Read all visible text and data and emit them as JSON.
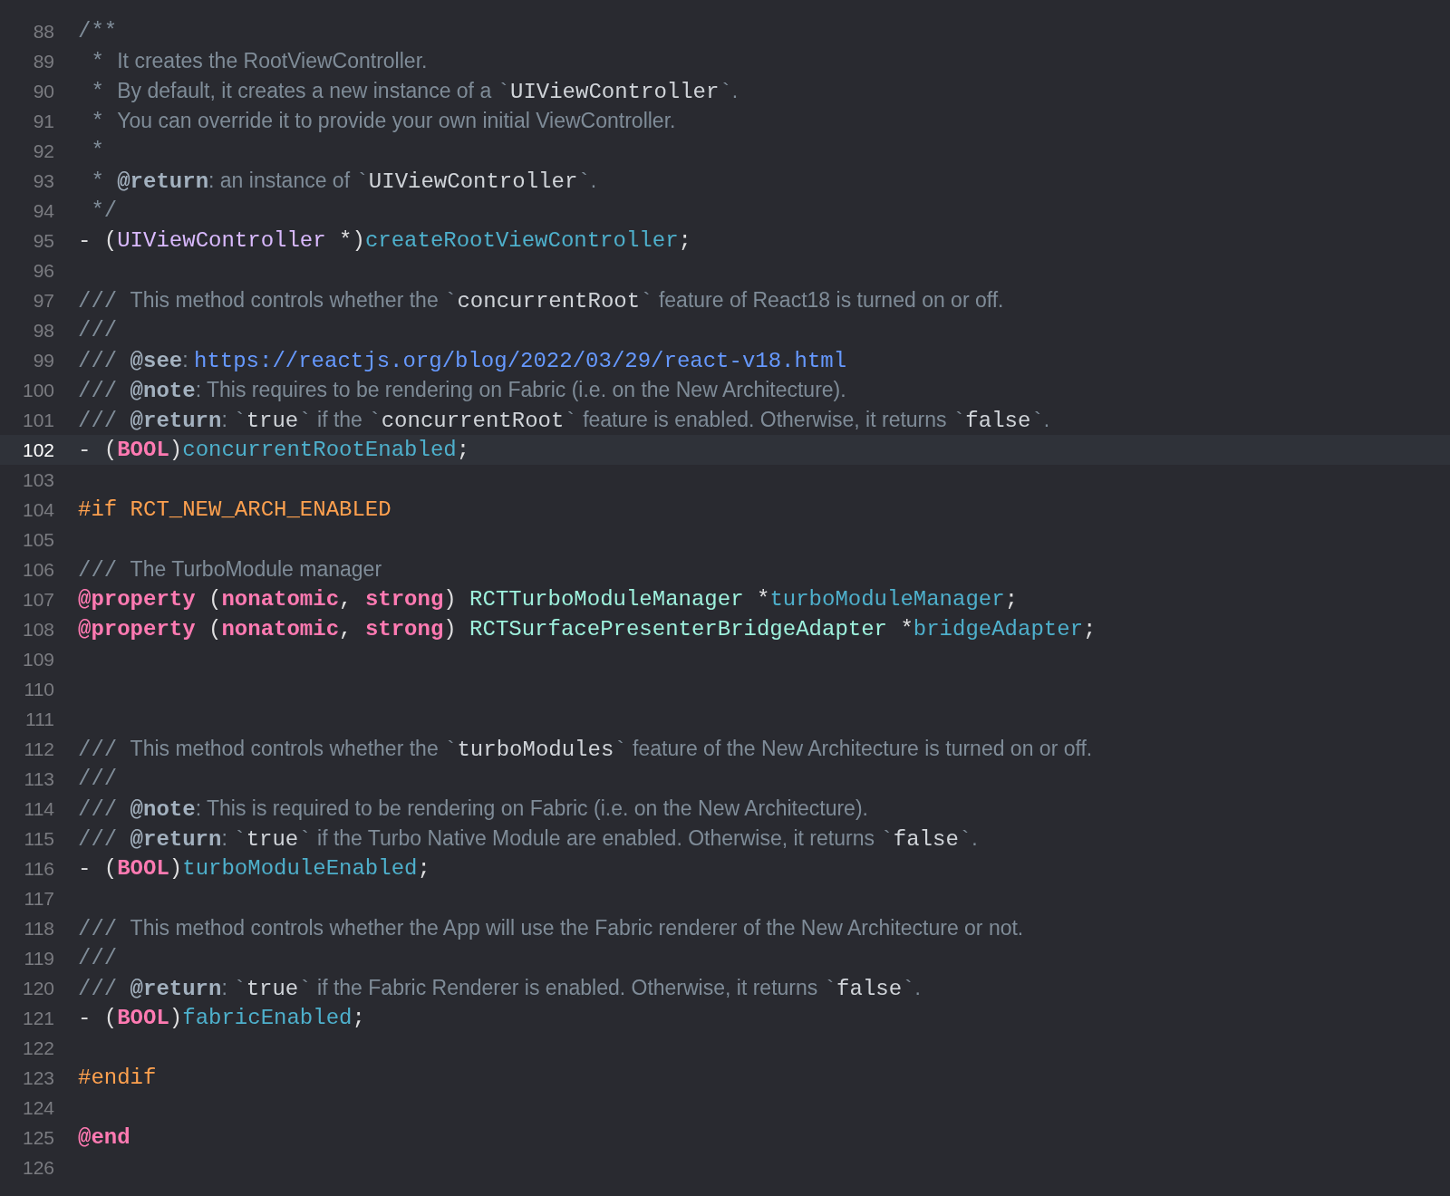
{
  "editor": {
    "lines": [
      {
        "n": "88",
        "current": false,
        "tokens": [
          {
            "kind": "mark",
            "text": "/**"
          }
        ]
      },
      {
        "n": "89",
        "current": false,
        "tokens": [
          {
            "kind": "mark",
            "text": " * "
          },
          {
            "kind": "comment",
            "text": "It creates the RootViewController."
          }
        ]
      },
      {
        "n": "90",
        "current": false,
        "tokens": [
          {
            "kind": "mark",
            "text": " * "
          },
          {
            "kind": "comment",
            "text": "By default, it creates a new instance of a "
          },
          {
            "kind": "mark",
            "text": "`"
          },
          {
            "kind": "code",
            "text": "UIViewController"
          },
          {
            "kind": "mark",
            "text": "`"
          },
          {
            "kind": "comment",
            "text": "."
          }
        ]
      },
      {
        "n": "91",
        "current": false,
        "tokens": [
          {
            "kind": "mark",
            "text": " * "
          },
          {
            "kind": "comment",
            "text": "You can override it to provide your own initial ViewController."
          }
        ]
      },
      {
        "n": "92",
        "current": false,
        "tokens": [
          {
            "kind": "mark",
            "text": " *"
          }
        ]
      },
      {
        "n": "93",
        "current": false,
        "tokens": [
          {
            "kind": "mark",
            "text": " * "
          },
          {
            "kind": "tag",
            "text": "@return"
          },
          {
            "kind": "comment",
            "text": ": an instance of "
          },
          {
            "kind": "mark",
            "text": "`"
          },
          {
            "kind": "code",
            "text": "UIViewController"
          },
          {
            "kind": "mark",
            "text": "`"
          },
          {
            "kind": "comment",
            "text": "."
          }
        ]
      },
      {
        "n": "94",
        "current": false,
        "tokens": [
          {
            "kind": "mark",
            "text": " */"
          }
        ]
      },
      {
        "n": "95",
        "current": false,
        "tokens": [
          {
            "kind": "plain",
            "text": "- ("
          },
          {
            "kind": "type",
            "text": "UIViewController"
          },
          {
            "kind": "plain",
            "text": " *)"
          },
          {
            "kind": "method",
            "text": "createRootViewController"
          },
          {
            "kind": "plain",
            "text": ";"
          }
        ]
      },
      {
        "n": "96",
        "current": false
      },
      {
        "n": "97",
        "current": false,
        "tokens": [
          {
            "kind": "mark",
            "text": "/// "
          },
          {
            "kind": "comment",
            "text": "This method controls whether the "
          },
          {
            "kind": "mark",
            "text": "`"
          },
          {
            "kind": "code",
            "text": "concurrentRoot"
          },
          {
            "kind": "mark",
            "text": "`"
          },
          {
            "kind": "comment",
            "text": " feature of React18 is turned on or off."
          }
        ]
      },
      {
        "n": "98",
        "current": false,
        "tokens": [
          {
            "kind": "mark",
            "text": "///"
          }
        ]
      },
      {
        "n": "99",
        "current": false,
        "tokens": [
          {
            "kind": "mark",
            "text": "/// "
          },
          {
            "kind": "tag",
            "text": "@see"
          },
          {
            "kind": "comment",
            "text": ": "
          },
          {
            "kind": "link",
            "text": "https://reactjs.org/blog/2022/03/29/react-v18.html"
          }
        ]
      },
      {
        "n": "100",
        "current": false,
        "tokens": [
          {
            "kind": "mark",
            "text": "/// "
          },
          {
            "kind": "tag",
            "text": "@note"
          },
          {
            "kind": "comment",
            "text": ": This requires to be rendering on Fabric (i.e. on the New Architecture)."
          }
        ]
      },
      {
        "n": "101",
        "current": false,
        "tokens": [
          {
            "kind": "mark",
            "text": "/// "
          },
          {
            "kind": "tag",
            "text": "@return"
          },
          {
            "kind": "comment",
            "text": ": "
          },
          {
            "kind": "mark",
            "text": "`"
          },
          {
            "kind": "code",
            "text": "true"
          },
          {
            "kind": "mark",
            "text": "`"
          },
          {
            "kind": "comment",
            "text": " if the "
          },
          {
            "kind": "mark",
            "text": "`"
          },
          {
            "kind": "code",
            "text": "concurrentRoot"
          },
          {
            "kind": "mark",
            "text": "`"
          },
          {
            "kind": "comment",
            "text": " feature is enabled. Otherwise, it returns "
          },
          {
            "kind": "mark",
            "text": "`"
          },
          {
            "kind": "code",
            "text": "false"
          },
          {
            "kind": "mark",
            "text": "`"
          },
          {
            "kind": "comment",
            "text": "."
          }
        ]
      },
      {
        "n": "102",
        "current": true,
        "tokens": [
          {
            "kind": "plain",
            "text": "- ("
          },
          {
            "kind": "keyword",
            "text": "BOOL"
          },
          {
            "kind": "plain",
            "text": ")"
          },
          {
            "kind": "method",
            "text": "concurrentRootEnabled"
          },
          {
            "kind": "plain",
            "text": ";"
          }
        ]
      },
      {
        "n": "103",
        "current": false
      },
      {
        "n": "104",
        "current": false,
        "tokens": [
          {
            "kind": "preproc",
            "text": "#if RCT_NEW_ARCH_ENABLED"
          }
        ]
      },
      {
        "n": "105",
        "current": false
      },
      {
        "n": "106",
        "current": false,
        "tokens": [
          {
            "kind": "mark",
            "text": "/// "
          },
          {
            "kind": "comment",
            "text": "The TurboModule manager"
          }
        ]
      },
      {
        "n": "107",
        "current": false,
        "tokens": [
          {
            "kind": "keyword",
            "text": "@property"
          },
          {
            "kind": "plain",
            "text": " ("
          },
          {
            "kind": "keyword",
            "text": "nonatomic"
          },
          {
            "kind": "plain",
            "text": ", "
          },
          {
            "kind": "keyword",
            "text": "strong"
          },
          {
            "kind": "plain",
            "text": ") "
          },
          {
            "kind": "class",
            "text": "RCTTurboModuleManager"
          },
          {
            "kind": "plain",
            "text": " *"
          },
          {
            "kind": "method",
            "text": "turboModuleManager"
          },
          {
            "kind": "plain",
            "text": ";"
          }
        ]
      },
      {
        "n": "108",
        "current": false,
        "tokens": [
          {
            "kind": "keyword",
            "text": "@property"
          },
          {
            "kind": "plain",
            "text": " ("
          },
          {
            "kind": "keyword",
            "text": "nonatomic"
          },
          {
            "kind": "plain",
            "text": ", "
          },
          {
            "kind": "keyword",
            "text": "strong"
          },
          {
            "kind": "plain",
            "text": ") "
          },
          {
            "kind": "class",
            "text": "RCTSurfacePresenterBridgeAdapter"
          },
          {
            "kind": "plain",
            "text": " *"
          },
          {
            "kind": "method",
            "text": "bridgeAdapter"
          },
          {
            "kind": "plain",
            "text": ";"
          }
        ]
      },
      {
        "n": "109",
        "current": false
      },
      {
        "n": "110",
        "current": false
      },
      {
        "n": "111",
        "current": false
      },
      {
        "n": "112",
        "current": false,
        "tokens": [
          {
            "kind": "mark",
            "text": "/// "
          },
          {
            "kind": "comment",
            "text": "This method controls whether the "
          },
          {
            "kind": "mark",
            "text": "`"
          },
          {
            "kind": "code",
            "text": "turboModules"
          },
          {
            "kind": "mark",
            "text": "`"
          },
          {
            "kind": "comment",
            "text": " feature of the New Architecture is turned on or off."
          }
        ]
      },
      {
        "n": "113",
        "current": false,
        "tokens": [
          {
            "kind": "mark",
            "text": "///"
          }
        ]
      },
      {
        "n": "114",
        "current": false,
        "tokens": [
          {
            "kind": "mark",
            "text": "/// "
          },
          {
            "kind": "tag",
            "text": "@note"
          },
          {
            "kind": "comment",
            "text": ": This is required to be rendering on Fabric (i.e. on the New Architecture)."
          }
        ]
      },
      {
        "n": "115",
        "current": false,
        "tokens": [
          {
            "kind": "mark",
            "text": "/// "
          },
          {
            "kind": "tag",
            "text": "@return"
          },
          {
            "kind": "comment",
            "text": ": "
          },
          {
            "kind": "mark",
            "text": "`"
          },
          {
            "kind": "code",
            "text": "true"
          },
          {
            "kind": "mark",
            "text": "`"
          },
          {
            "kind": "comment",
            "text": " if the Turbo Native Module are enabled. Otherwise, it returns "
          },
          {
            "kind": "mark",
            "text": "`"
          },
          {
            "kind": "code",
            "text": "false"
          },
          {
            "kind": "mark",
            "text": "`"
          },
          {
            "kind": "comment",
            "text": "."
          }
        ]
      },
      {
        "n": "116",
        "current": false,
        "tokens": [
          {
            "kind": "plain",
            "text": "- ("
          },
          {
            "kind": "keyword",
            "text": "BOOL"
          },
          {
            "kind": "plain",
            "text": ")"
          },
          {
            "kind": "method",
            "text": "turboModuleEnabled"
          },
          {
            "kind": "plain",
            "text": ";"
          }
        ]
      },
      {
        "n": "117",
        "current": false
      },
      {
        "n": "118",
        "current": false,
        "tokens": [
          {
            "kind": "mark",
            "text": "/// "
          },
          {
            "kind": "comment",
            "text": "This method controls whether the App will use the Fabric renderer of the New Architecture or not."
          }
        ]
      },
      {
        "n": "119",
        "current": false,
        "tokens": [
          {
            "kind": "mark",
            "text": "///"
          }
        ]
      },
      {
        "n": "120",
        "current": false,
        "tokens": [
          {
            "kind": "mark",
            "text": "/// "
          },
          {
            "kind": "tag",
            "text": "@return"
          },
          {
            "kind": "comment",
            "text": ": "
          },
          {
            "kind": "mark",
            "text": "`"
          },
          {
            "kind": "code",
            "text": "true"
          },
          {
            "kind": "mark",
            "text": "`"
          },
          {
            "kind": "comment",
            "text": " if the Fabric Renderer is enabled. Otherwise, it returns "
          },
          {
            "kind": "mark",
            "text": "`"
          },
          {
            "kind": "code",
            "text": "false"
          },
          {
            "kind": "mark",
            "text": "`"
          },
          {
            "kind": "comment",
            "text": "."
          }
        ]
      },
      {
        "n": "121",
        "current": false,
        "tokens": [
          {
            "kind": "plain",
            "text": "- ("
          },
          {
            "kind": "keyword",
            "text": "BOOL"
          },
          {
            "kind": "plain",
            "text": ")"
          },
          {
            "kind": "method",
            "text": "fabricEnabled"
          },
          {
            "kind": "plain",
            "text": ";"
          }
        ]
      },
      {
        "n": "122",
        "current": false
      },
      {
        "n": "123",
        "current": false,
        "tokens": [
          {
            "kind": "preproc",
            "text": "#endif"
          }
        ]
      },
      {
        "n": "124",
        "current": false
      },
      {
        "n": "125",
        "current": false,
        "tokens": [
          {
            "kind": "keyword",
            "text": "@end"
          }
        ]
      },
      {
        "n": "126",
        "current": false
      }
    ]
  }
}
